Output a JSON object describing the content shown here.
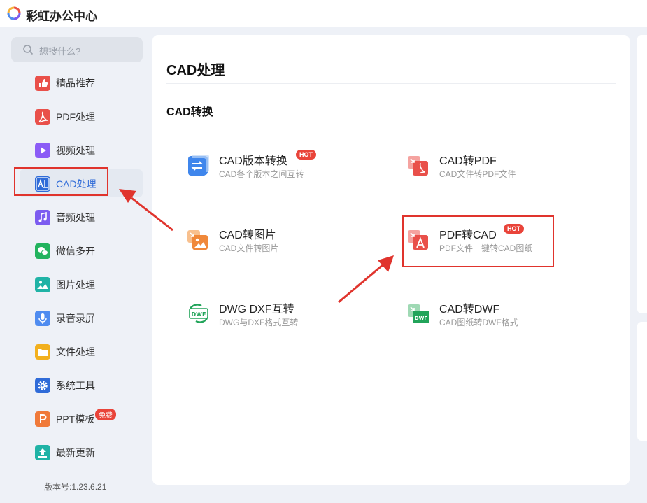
{
  "app": {
    "title": "彩虹办公中心"
  },
  "search": {
    "placeholder": "想搜什么?"
  },
  "sidebar": {
    "items": [
      {
        "label": "精品推荐",
        "icon": "thumbs-up-icon",
        "color": "#e9504a"
      },
      {
        "label": "PDF处理",
        "icon": "pdf-icon",
        "color": "#e9504a"
      },
      {
        "label": "视频处理",
        "icon": "play-icon",
        "color": "#8b5cf6"
      },
      {
        "label": "CAD处理",
        "icon": "cad-icon",
        "color": "#2f6bd8",
        "active": true
      },
      {
        "label": "音频处理",
        "icon": "music-icon",
        "color": "#7c5cf0"
      },
      {
        "label": "微信多开",
        "icon": "wechat-icon",
        "color": "#22b35e"
      },
      {
        "label": "图片处理",
        "icon": "image-icon",
        "color": "#20b3a6"
      },
      {
        "label": "录音录屏",
        "icon": "microphone-icon",
        "color": "#4f8cf0"
      },
      {
        "label": "文件处理",
        "icon": "folder-icon",
        "color": "#f2b01e"
      },
      {
        "label": "系统工具",
        "icon": "gear-icon",
        "color": "#2f6bd8"
      },
      {
        "label": "PPT模板",
        "icon": "ppt-icon",
        "color": "#f07a3a",
        "badge": "免费"
      },
      {
        "label": "最新更新",
        "icon": "upload-icon",
        "color": "#20b3a6"
      }
    ],
    "version": "版本号:1.23.6.21"
  },
  "main": {
    "title": "CAD处理",
    "group_title": "CAD转换",
    "tools": [
      {
        "name": "CAD版本转换",
        "desc": "CAD各个版本之间互转",
        "badge": "HOT",
        "icon": "cad-version-icon"
      },
      {
        "name": "CAD转PDF",
        "desc": "CAD文件转PDF文件",
        "icon": "cad-to-pdf-icon"
      },
      {
        "name": "CAD转图片",
        "desc": "CAD文件转图片",
        "icon": "cad-to-image-icon"
      },
      {
        "name": "PDF转CAD",
        "desc": "PDF文件一键转CAD图纸",
        "badge": "HOT",
        "icon": "pdf-to-cad-icon"
      },
      {
        "name": "DWG DXF互转",
        "desc": "DWG与DXF格式互转",
        "icon": "dwg-dxf-icon"
      },
      {
        "name": "CAD转DWF",
        "desc": "CAD图纸转DWF格式",
        "icon": "cad-to-dwf-icon"
      }
    ]
  },
  "colors": {
    "accent": "#2f6bd8",
    "hot": "#e9443a",
    "annotation": "#e0342d"
  }
}
